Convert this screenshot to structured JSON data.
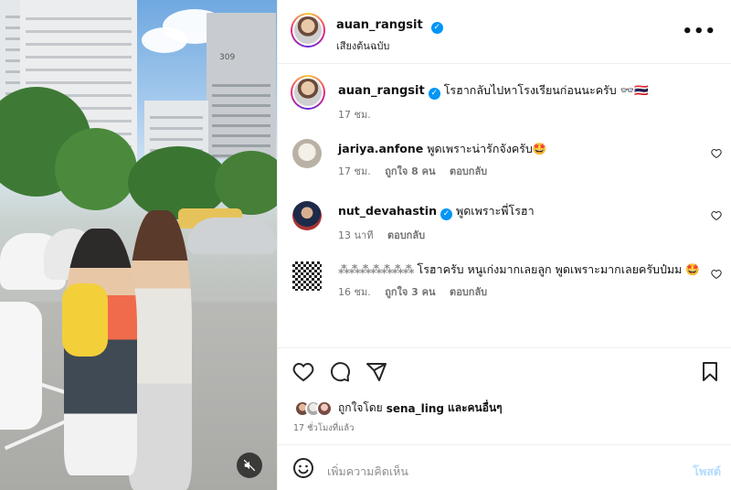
{
  "post": {
    "username": "auan_rangsit",
    "audio": "เสียงต้นฉบับ",
    "more_label": "•••"
  },
  "caption": {
    "username": "auan_rangsit",
    "text": "โรฮากลับไปหาโรงเรียนก่อนนะครับ 👓🇹🇭",
    "time": "17 ชม."
  },
  "comments": [
    {
      "username": "jariya.anfone",
      "verified": false,
      "text": "พูดเพราะน่ารักจังครับ🤩",
      "time": "17 ชม.",
      "likes": "ถูกใจ 8 คน",
      "reply": "ตอบกลับ"
    },
    {
      "username": "nut_devahastin",
      "verified": true,
      "text": "พูดเพราะพี่โรฮา",
      "time": "13 นาที",
      "likes": "",
      "reply": "ตอบกลับ"
    },
    {
      "username": "⁂⁂⁂⁂⁂⁂⁂",
      "verified": false,
      "text": "โรฮาครับ หนูเก่งมากเลยลูก พูดเพราะมากเลยครับป๋มม 🤩",
      "time": "16 ชม.",
      "likes": "ถูกใจ 3 คน",
      "reply": "ตอบกลับ"
    }
  ],
  "actions": {
    "liked_by": "ถูกใจโดย",
    "liked_user": "sena_ling",
    "and_others": "และคนอื่นๆ",
    "time_ago": "17 ชั่วโมงที่แล้ว"
  },
  "add_comment": {
    "placeholder": "เพิ่มความคิดเห็น",
    "post_label": "โพสต์"
  },
  "photo": {
    "building_number": "309"
  },
  "colors": {
    "verified": "#0095f6",
    "post_disabled": "#b3dbff",
    "heart_red": "#ed4956"
  }
}
